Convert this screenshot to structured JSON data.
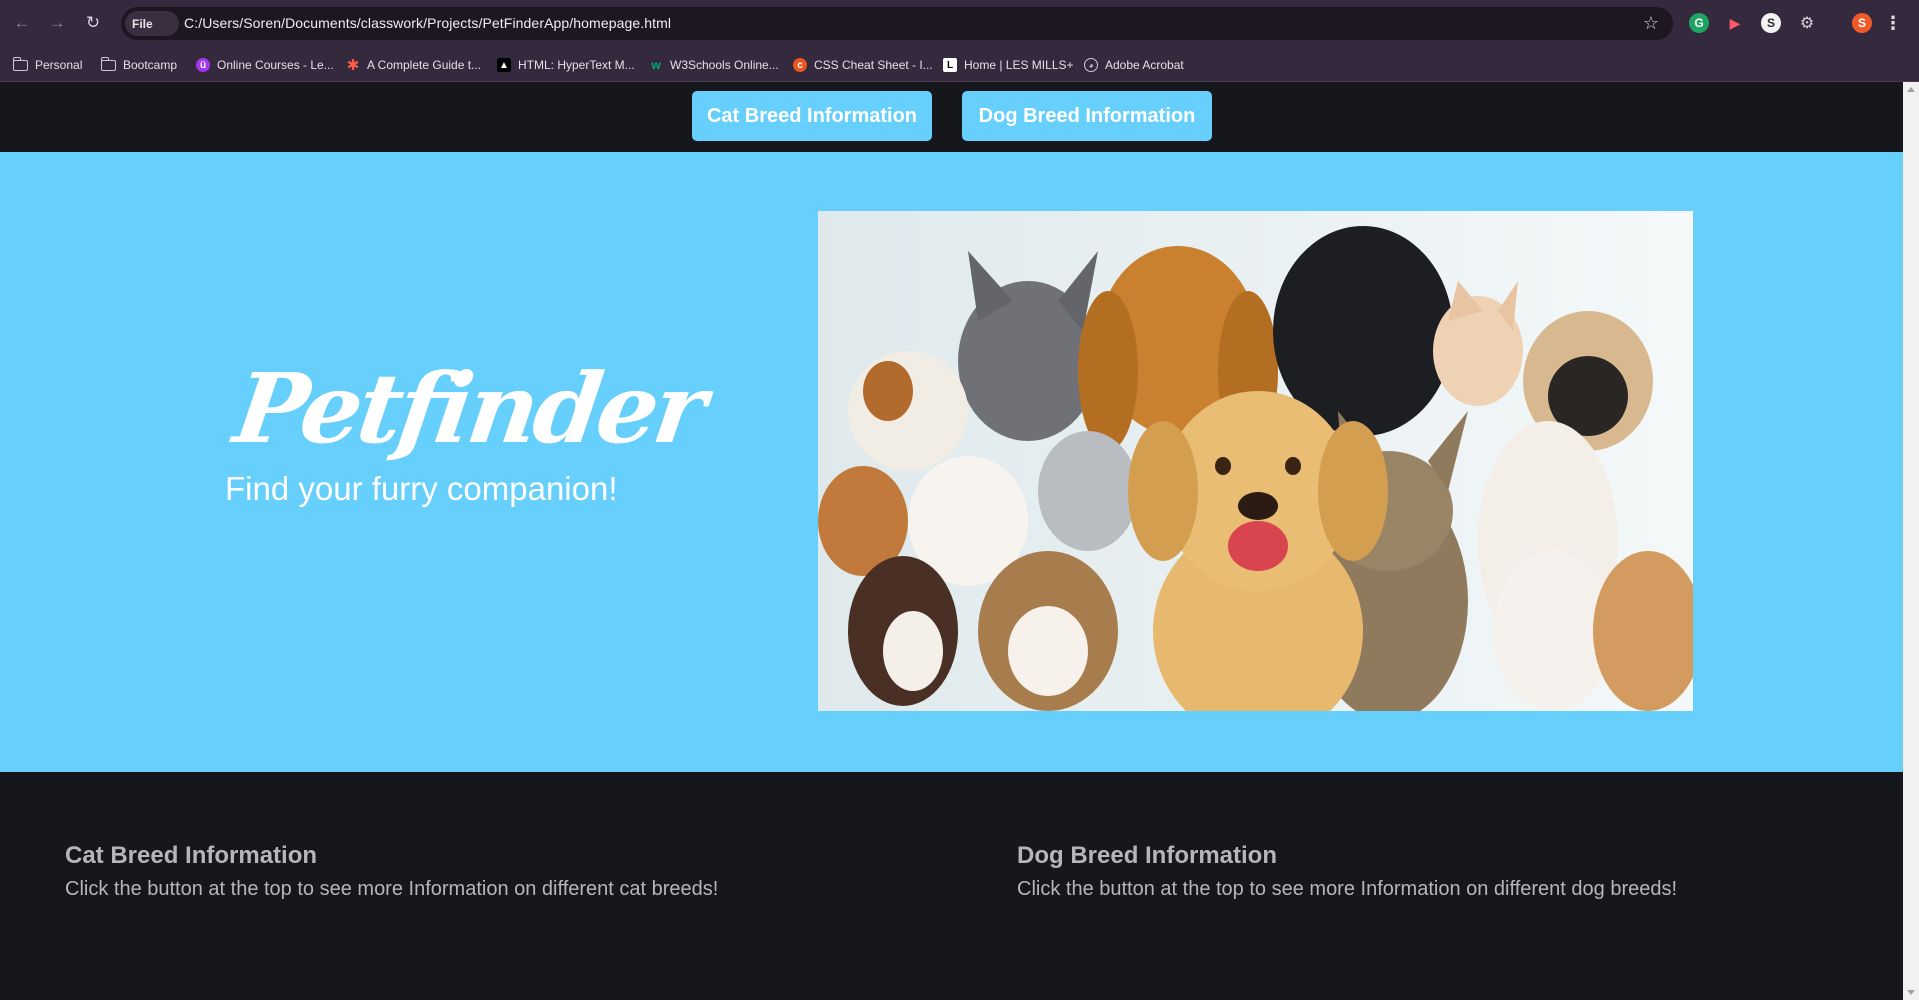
{
  "browser": {
    "url_chip": "File",
    "url": "C:/Users/Soren/Documents/classwork/Projects/PetFinderApp/homepage.html",
    "profile_initial": "S",
    "bookmarks": [
      {
        "label": "Personal",
        "icon": "folder-icon"
      },
      {
        "label": "Bootcamp",
        "icon": "folder-icon"
      },
      {
        "label": "Online Courses - Le...",
        "icon": "udemy-icon"
      },
      {
        "label": "A Complete Guide t...",
        "icon": "asterisk-icon"
      },
      {
        "label": "HTML: HyperText M...",
        "icon": "mdn-icon"
      },
      {
        "label": "W3Schools Online...",
        "icon": "w3schools-icon"
      },
      {
        "label": "CSS Cheat Sheet - I...",
        "icon": "css-icon"
      },
      {
        "label": "Home | LES MILLS+",
        "icon": "lesmills-icon"
      },
      {
        "label": "Adobe Acrobat",
        "icon": "globe-icon"
      }
    ]
  },
  "nav": {
    "cat_button": "Cat Breed Information",
    "dog_button": "Dog Breed Information"
  },
  "hero": {
    "logo": "Petfinder",
    "tagline": "Find your furry companion!",
    "image_alt": "group of cats and dogs"
  },
  "sections": {
    "cat": {
      "heading": "Cat Breed Information",
      "text": "Click the button at the top to see more Information on different cat breeds!"
    },
    "dog": {
      "heading": "Dog Breed Information",
      "text": "Click the button at the top to see more Information on different dog breeds!"
    }
  },
  "colors": {
    "accent": "#66cffc",
    "page_bg": "#16171c",
    "browser_bg": "#35293d"
  }
}
